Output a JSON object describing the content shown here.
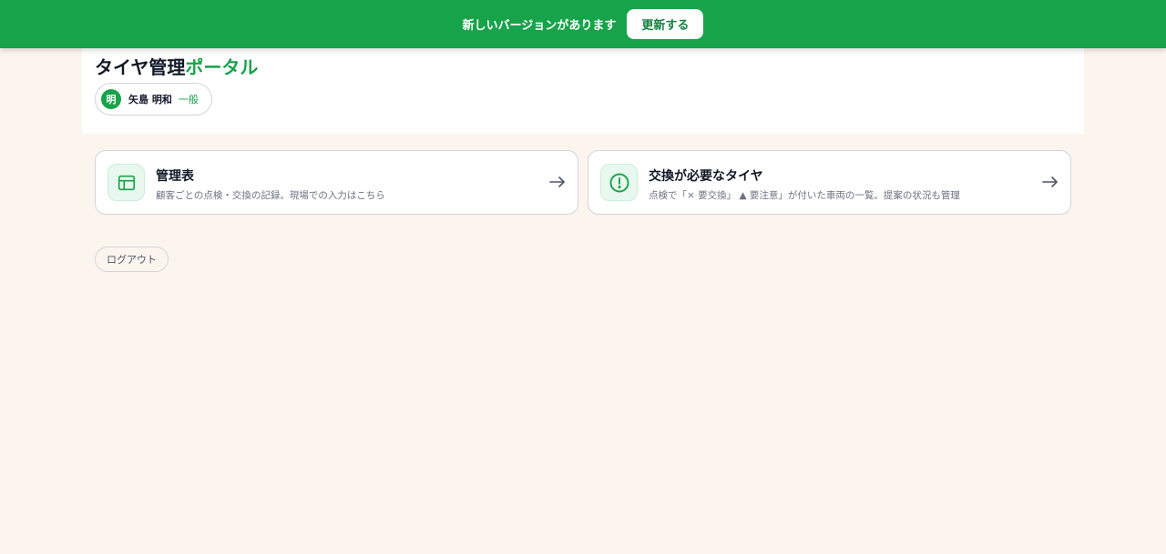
{
  "update_banner": {
    "message": "新しいバージョンがあります",
    "button_label": "更新する",
    "color": "#17a34a"
  },
  "header": {
    "title_main": "タイヤ管理",
    "title_accent": "ポータル",
    "user": {
      "avatar_initial": "明",
      "name": "矢島 明和",
      "role": "一般"
    }
  },
  "cards": [
    {
      "title": "管理表",
      "description": "顧客ごとの点検・交換の記録。現場での入力はこちら",
      "icon": "table-icon"
    },
    {
      "title": "交換が必要なタイヤ",
      "description": "点検で「× 要交換」 ▲ 要注意」が付いた車両の一覧。提案の状況も管理",
      "icon": "alert-circle-icon"
    }
  ],
  "logout_label": "ログアウト",
  "colors": {
    "accent": "#17a34a",
    "background": "#fcf5ee"
  }
}
